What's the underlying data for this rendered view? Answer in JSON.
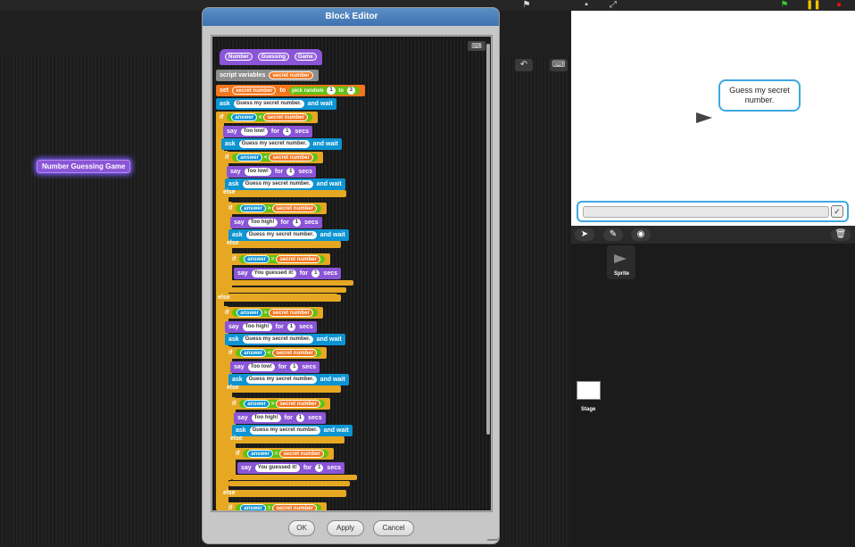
{
  "dialog": {
    "title": "Block Editor",
    "ok_label": "OK",
    "apply_label": "Apply",
    "cancel_label": "Cancel"
  },
  "floating_block": {
    "label": "Number Guessing Game"
  },
  "stage": {
    "bubble_text": "Guess my secret number.",
    "ok_glyph": "✓"
  },
  "corral": {
    "sprite_label": "Sprite",
    "stage_label": "Stage"
  },
  "icons": {
    "flag": "green-flag-icon",
    "pause": "pause-icon",
    "stop": "stop-icon"
  },
  "colors": {
    "custom": "#8a55d7",
    "variables": "#f3761d",
    "sensing": "#0d94d2",
    "control": "#e6a822",
    "operators": "#62c213",
    "title_bar": "#4a80bb"
  },
  "script": {
    "hat": [
      "Number",
      "Guessing",
      "Game"
    ],
    "script_variables": "script variables",
    "secret_number": "secret number",
    "set": "set",
    "to": "to",
    "pick_random": "pick random",
    "random_from": "1",
    "random_to": "3",
    "ask": "ask",
    "ask_prompt": "Guess my secret number.",
    "and_wait": "and wait",
    "if": "if",
    "else": "else",
    "answer": "answer",
    "lt": "<",
    "gt": ">",
    "eq": "=",
    "say": "say",
    "too_low": "Too low!",
    "too_high": "Too high!",
    "you_guessed": "You guessed it!",
    "for": "for",
    "secs": "secs",
    "one": "1"
  }
}
